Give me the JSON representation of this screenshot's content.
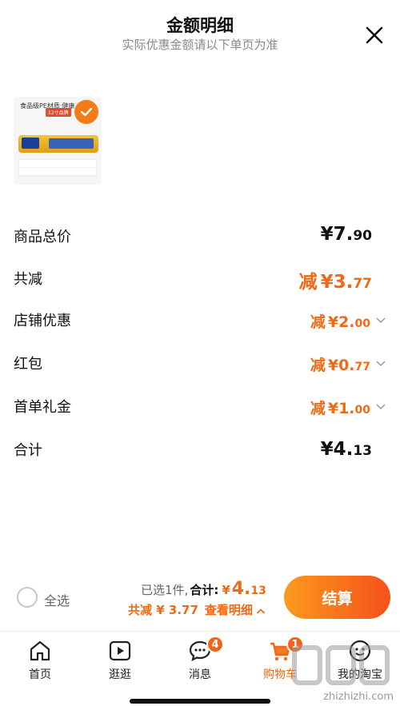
{
  "header": {
    "title": "金额明细",
    "subtitle": "实际优惠金额请以下单页为准",
    "close_icon": "close-icon"
  },
  "product": {
    "thumb_text": "食品级PE材质·健康",
    "thumb_badge": "12寸品牌",
    "selected": true
  },
  "rows": [
    {
      "label": "商品总价",
      "currency": "¥",
      "int": "7.",
      "dec": "90",
      "prefix": "",
      "style": "black-big"
    },
    {
      "label": "共减",
      "currency": "¥",
      "int": "3.",
      "dec": "77",
      "prefix": "减",
      "style": "orange-big"
    },
    {
      "label": "店铺优惠",
      "currency": "¥",
      "int": "2.",
      "dec": "00",
      "prefix": "减",
      "style": "orange-mid",
      "expandable": true
    },
    {
      "label": "红包",
      "currency": "¥",
      "int": "0.",
      "dec": "77",
      "prefix": "减",
      "style": "orange-mid",
      "expandable": true
    },
    {
      "label": "首单礼金",
      "currency": "¥",
      "int": "1.",
      "dec": "00",
      "prefix": "减",
      "style": "orange-mid",
      "expandable": true
    },
    {
      "label": "合计",
      "currency": "¥",
      "int": "4.",
      "dec": "13",
      "prefix": "",
      "style": "black-big"
    }
  ],
  "checkout": {
    "select_all_label": "全选",
    "selected_count_text": "已选1件,",
    "total_label": "合计:",
    "total_currency": "¥",
    "total_int": "4.",
    "total_dec": "13",
    "saved_text": "共减 ¥ 3.77",
    "view_detail_label": "查看明细",
    "pay_label": "结算"
  },
  "tabs": [
    {
      "label": "首页",
      "icon": "home-icon"
    },
    {
      "label": "逛逛",
      "icon": "play-icon"
    },
    {
      "label": "消息",
      "icon": "chat-icon",
      "badge": "4"
    },
    {
      "label": "购物车",
      "icon": "cart-icon",
      "badge": "1",
      "active": true
    },
    {
      "label": "我的淘宝",
      "icon": "taobao-icon"
    }
  ],
  "watermark": {
    "text": "zhizhizhi.com"
  },
  "colors": {
    "accent": "#f06a14",
    "pay_gradient_start": "#fb9a1e",
    "pay_gradient_end": "#f5511a"
  }
}
